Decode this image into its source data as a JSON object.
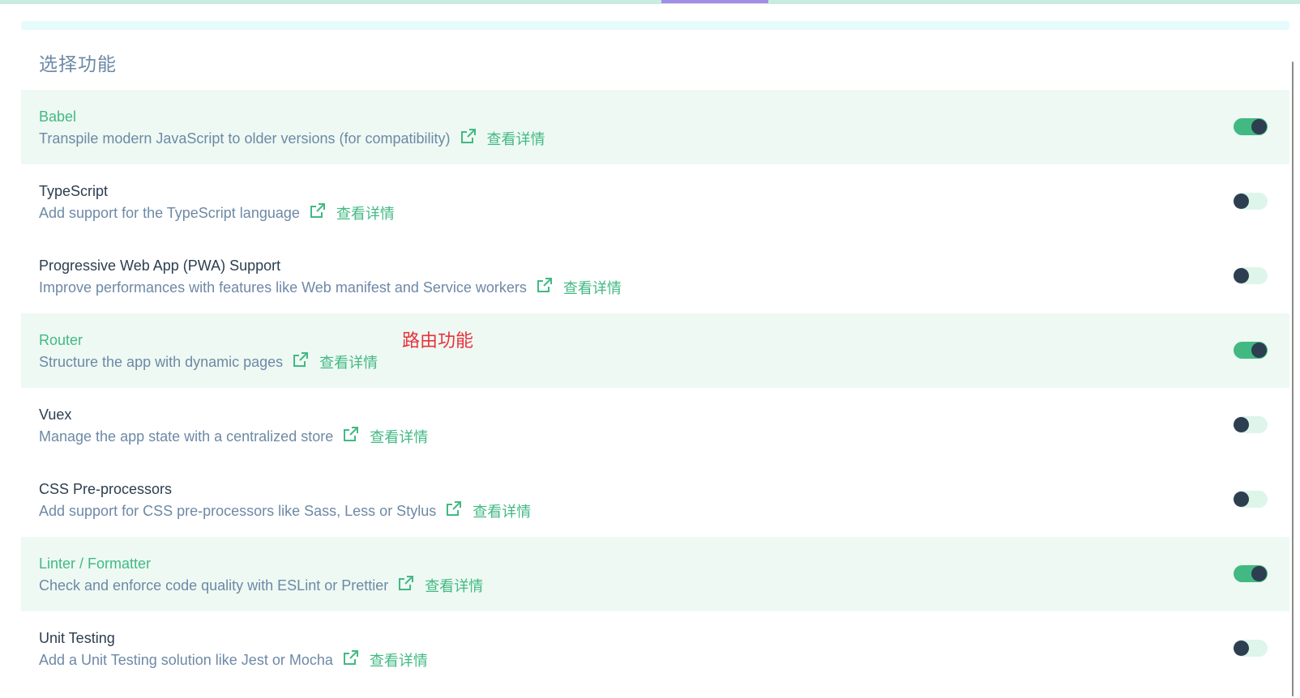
{
  "section": {
    "title": "选择功能"
  },
  "annotation": "路由功能",
  "colors": {
    "accent": "#42b983",
    "text_dark": "#2c3e50",
    "text_muted": "#6d89a6",
    "selected_bg": "#eef9f3",
    "annotation": "#e8323c"
  },
  "features": [
    {
      "name": "Babel",
      "description": "Transpile modern JavaScript to older versions (for compatibility)",
      "more_label": "查看详情",
      "enabled": true
    },
    {
      "name": "TypeScript",
      "description": "Add support for the TypeScript language",
      "more_label": "查看详情",
      "enabled": false
    },
    {
      "name": "Progressive Web App (PWA) Support",
      "description": "Improve performances with features like Web manifest and Service workers",
      "more_label": "查看详情",
      "enabled": false
    },
    {
      "name": "Router",
      "description": "Structure the app with dynamic pages",
      "more_label": "查看详情",
      "enabled": true
    },
    {
      "name": "Vuex",
      "description": "Manage the app state with a centralized store",
      "more_label": "查看详情",
      "enabled": false
    },
    {
      "name": "CSS Pre-processors",
      "description": "Add support for CSS pre-processors like Sass, Less or Stylus",
      "more_label": "查看详情",
      "enabled": false
    },
    {
      "name": "Linter / Formatter",
      "description": "Check and enforce code quality with ESLint or Prettier",
      "more_label": "查看详情",
      "enabled": true
    },
    {
      "name": "Unit Testing",
      "description": "Add a Unit Testing solution like Jest or Mocha",
      "more_label": "查看详情",
      "enabled": false
    }
  ]
}
